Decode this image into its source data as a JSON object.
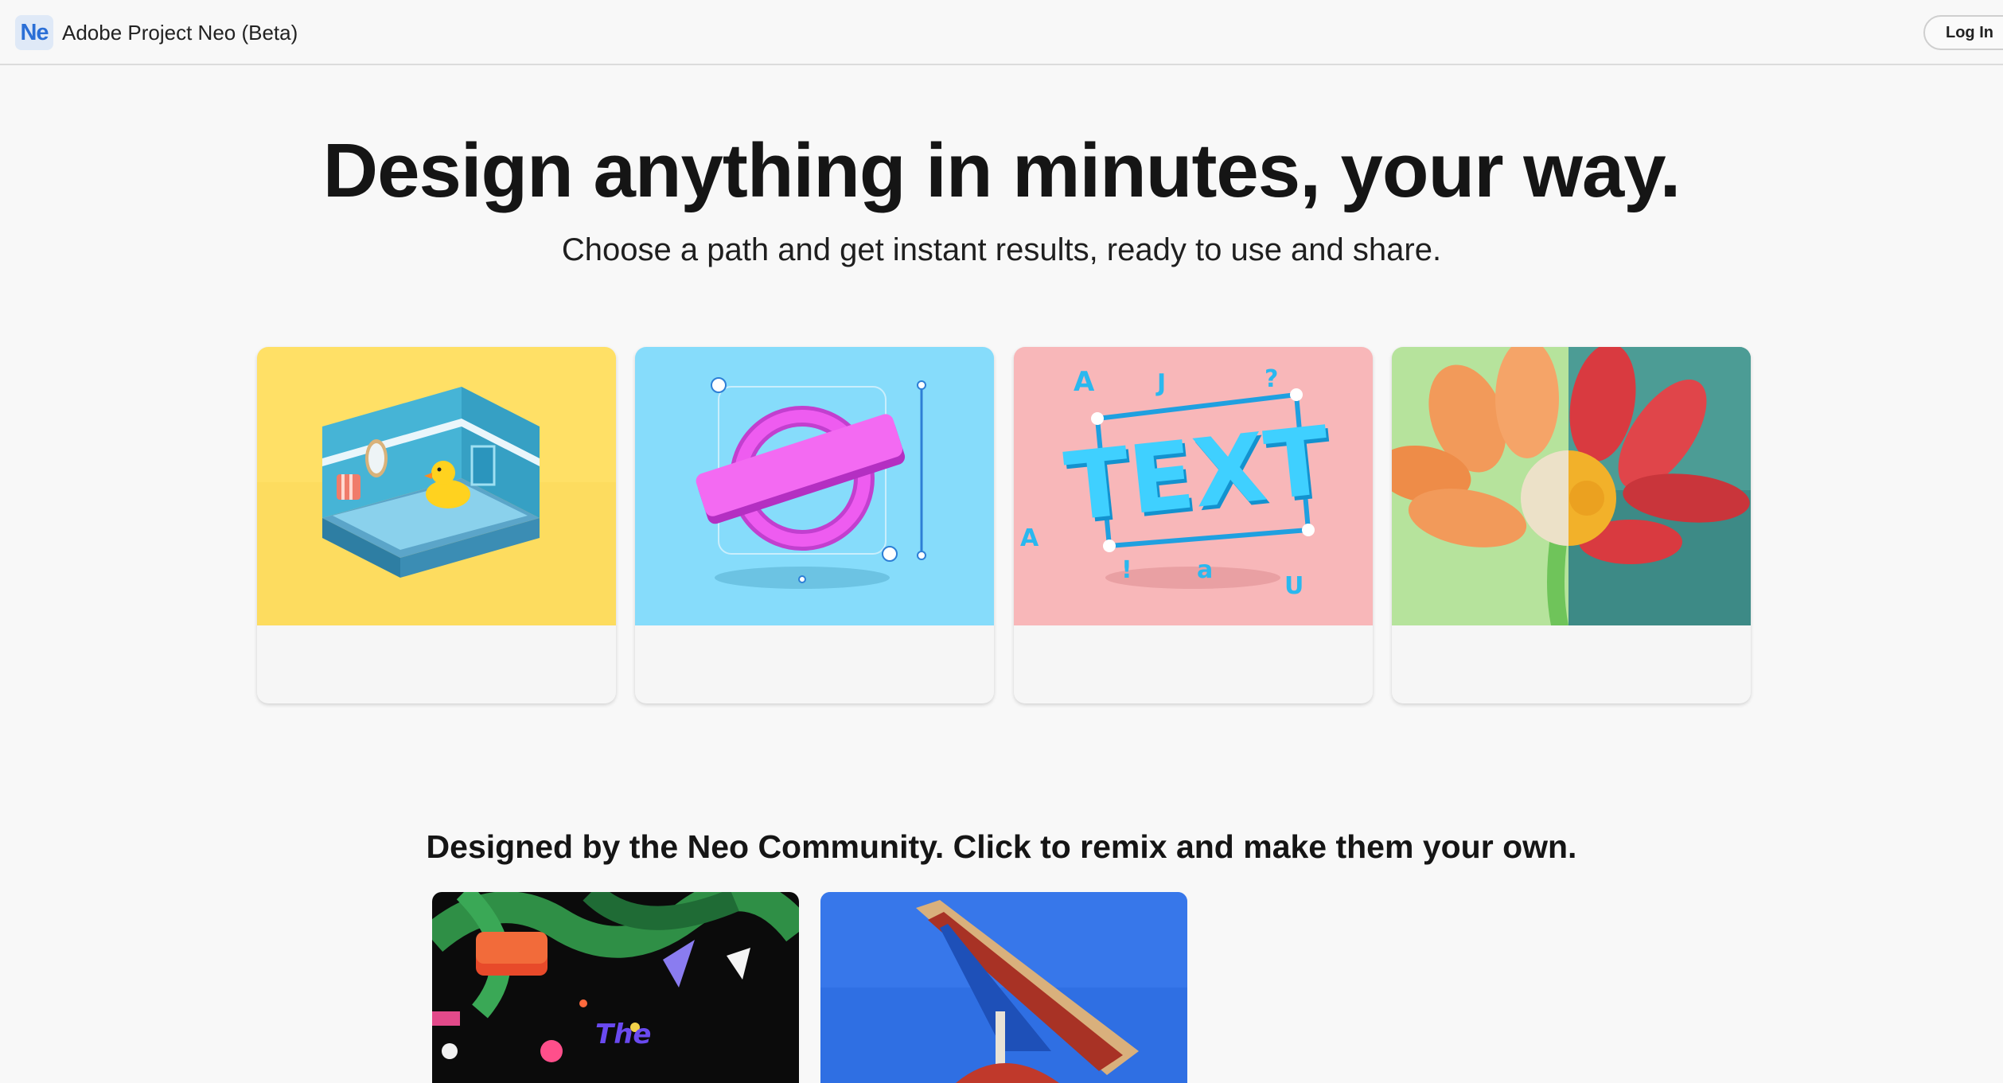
{
  "header": {
    "logo_text": "Ne",
    "app_name": "Adobe Project Neo (Beta)",
    "login_label": "Log In"
  },
  "hero": {
    "title": "Design anything in minutes, your way.",
    "subtitle": "Choose a path and get instant results, ready to use and share."
  },
  "paths": {
    "cards": [
      {
        "illustration": "isometric-bathroom-duck",
        "bg_color": "#ffe066"
      },
      {
        "illustration": "3d-logo-ring",
        "bg_color": "#86dcfb"
      },
      {
        "illustration": "3d-text-letters",
        "bg_color": "#f8b7b9",
        "art_text": "TEXT"
      },
      {
        "illustration": "flower-split-render",
        "bg_color_left": "#b6e39c",
        "bg_color_right": "#3d8a86"
      }
    ]
  },
  "community": {
    "title": "Designed by the Neo Community. Click to remix and make them your own.",
    "tiles": [
      {
        "illustration": "abstract-3d-shapes-dark",
        "art_text": "The"
      },
      {
        "illustration": "3d-arrow-blue-sky"
      }
    ]
  },
  "colors": {
    "background": "#f8f8f8",
    "brand_blue": "#2b6fd6",
    "text": "#151515"
  }
}
